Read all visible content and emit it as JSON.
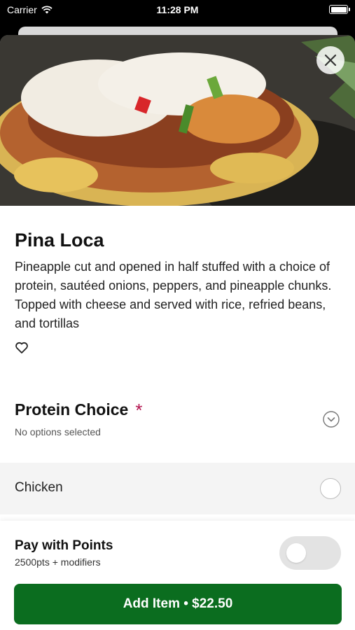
{
  "status_bar": {
    "carrier": "Carrier",
    "time": "11:28 PM",
    "icons": [
      "wifi-icon",
      "battery-icon"
    ]
  },
  "item": {
    "name": "Pina Loca",
    "description": "Pineapple cut and opened in half stuffed with a choice of protein, sautéed onions, peppers, and pineapple chunks. Topped with cheese and served with rice, refried beans, and tortillas",
    "favorite_icon": "heart-outline-icon",
    "image_icon": "food-photo"
  },
  "modifier_group": {
    "title": "Protein Choice",
    "required_marker": "*",
    "subtitle": "No options selected",
    "options": [
      {
        "label": "Chicken",
        "selected": false
      }
    ]
  },
  "footer": {
    "points_title": "Pay with Points",
    "points_subtitle": "2500pts + modifiers",
    "points_toggle_on": false,
    "add_button_label": "Add Item • $22.50"
  },
  "colors": {
    "accent": "#0b6d1f",
    "required": "#b3124e",
    "option_bg": "#f4f4f4"
  }
}
